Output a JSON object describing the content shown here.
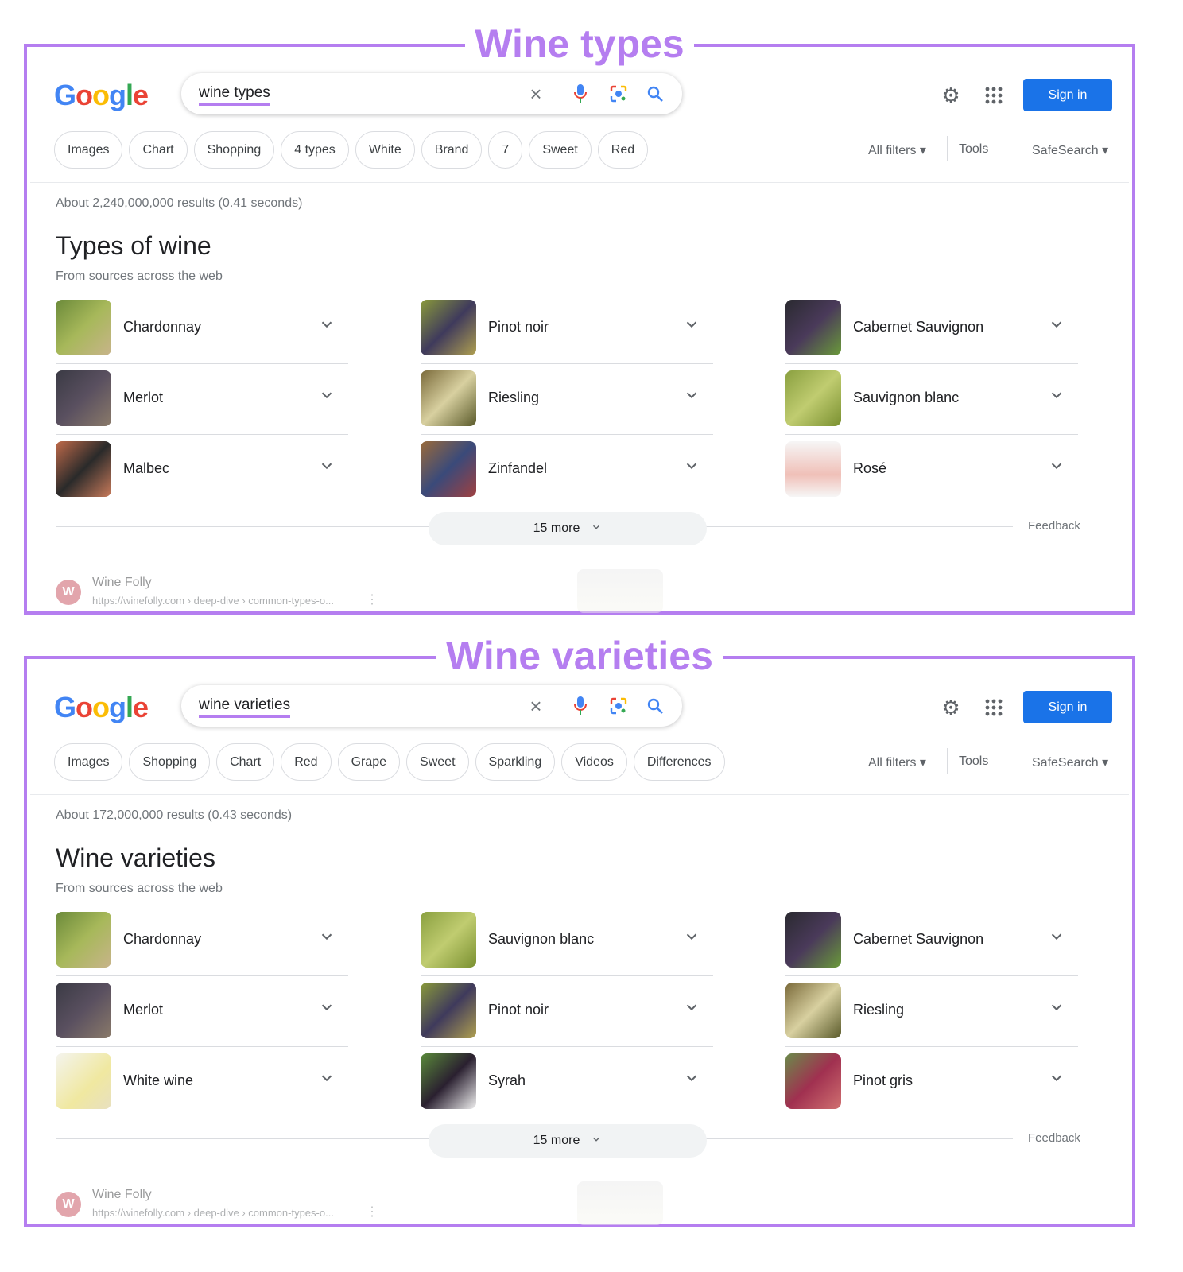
{
  "colors": {
    "annotation": "#b57ef0",
    "sign_in": "#1a73e8"
  },
  "panels": [
    {
      "annotation_title": "Wine types",
      "logo": "Google",
      "search": {
        "query": "wine types"
      },
      "icons": {
        "clear": "close-icon",
        "voice": "microphone-icon",
        "lens": "camera-lens-icon",
        "search": "search-icon",
        "settings": "gear-icon",
        "apps": "apps-grid-icon"
      },
      "sign_in": "Sign in",
      "chips": [
        "Images",
        "Chart",
        "Shopping",
        "4 types",
        "White",
        "Brand",
        "7",
        "Sweet",
        "Red"
      ],
      "all_filters": "All filters",
      "tools": "Tools",
      "safesearch": "SafeSearch",
      "stats": "About 2,240,000,000 results (0.41 seconds)",
      "heading": "Types of wine",
      "subheading": "From sources across the web",
      "items": [
        "Chardonnay",
        "Pinot noir",
        "Cabernet Sauvignon",
        "Merlot",
        "Riesling",
        "Sauvignon blanc",
        "Malbec",
        "Zinfandel",
        "Rosé"
      ],
      "more": "15 more",
      "feedback": "Feedback",
      "source": {
        "name": "Wine Folly",
        "url": "https://winefolly.com › deep-dive › common-types-o..."
      }
    },
    {
      "annotation_title": "Wine varieties",
      "logo": "Google",
      "search": {
        "query": "wine varieties"
      },
      "icons": {
        "clear": "close-icon",
        "voice": "microphone-icon",
        "lens": "camera-lens-icon",
        "search": "search-icon",
        "settings": "gear-icon",
        "apps": "apps-grid-icon"
      },
      "sign_in": "Sign in",
      "chips": [
        "Images",
        "Shopping",
        "Chart",
        "Red",
        "Grape",
        "Sweet",
        "Sparkling",
        "Videos",
        "Differences"
      ],
      "all_filters": "All filters",
      "tools": "Tools",
      "safesearch": "SafeSearch",
      "stats": "About 172,000,000 results (0.43 seconds)",
      "heading": "Wine varieties",
      "subheading": "From sources across the web",
      "items": [
        "Chardonnay",
        "Sauvignon blanc",
        "Cabernet Sauvignon",
        "Merlot",
        "Pinot noir",
        "Riesling",
        "White wine",
        "Syrah",
        "Pinot gris"
      ],
      "more": "15 more",
      "feedback": "Feedback",
      "source": {
        "name": "Wine Folly",
        "url": "https://winefolly.com › deep-dive › common-types-o..."
      }
    }
  ]
}
